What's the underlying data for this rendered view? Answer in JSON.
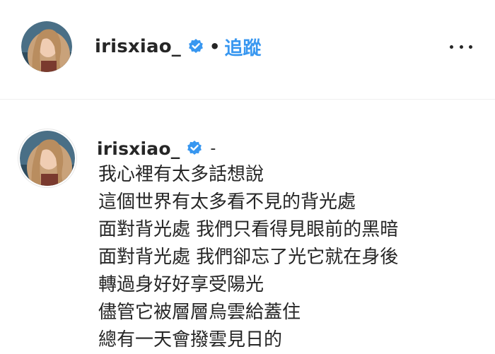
{
  "post_header": {
    "username": "irisxiao_",
    "separator": "•",
    "follow_label": "追蹤",
    "avatar_alt": "profile photo"
  },
  "comment": {
    "username": "irisxiao_",
    "trailing": "-",
    "caption_lines": [
      "我心裡有太多話想說",
      "這個世界有太多看不見的背光處",
      "面對背光處 我們只看得見眼前的黑暗",
      "面對背光處 我們卻忘了光它就在身後",
      "轉過身好好享受陽光",
      "儘管它被層層烏雲給蓋住",
      "總有一天會撥雲見日的"
    ]
  },
  "icons": {
    "verified": "verified-badge-icon",
    "more": "more-options-icon"
  },
  "colors": {
    "link_blue": "#3897f0",
    "text": "#262626",
    "divider": "#efefef"
  }
}
